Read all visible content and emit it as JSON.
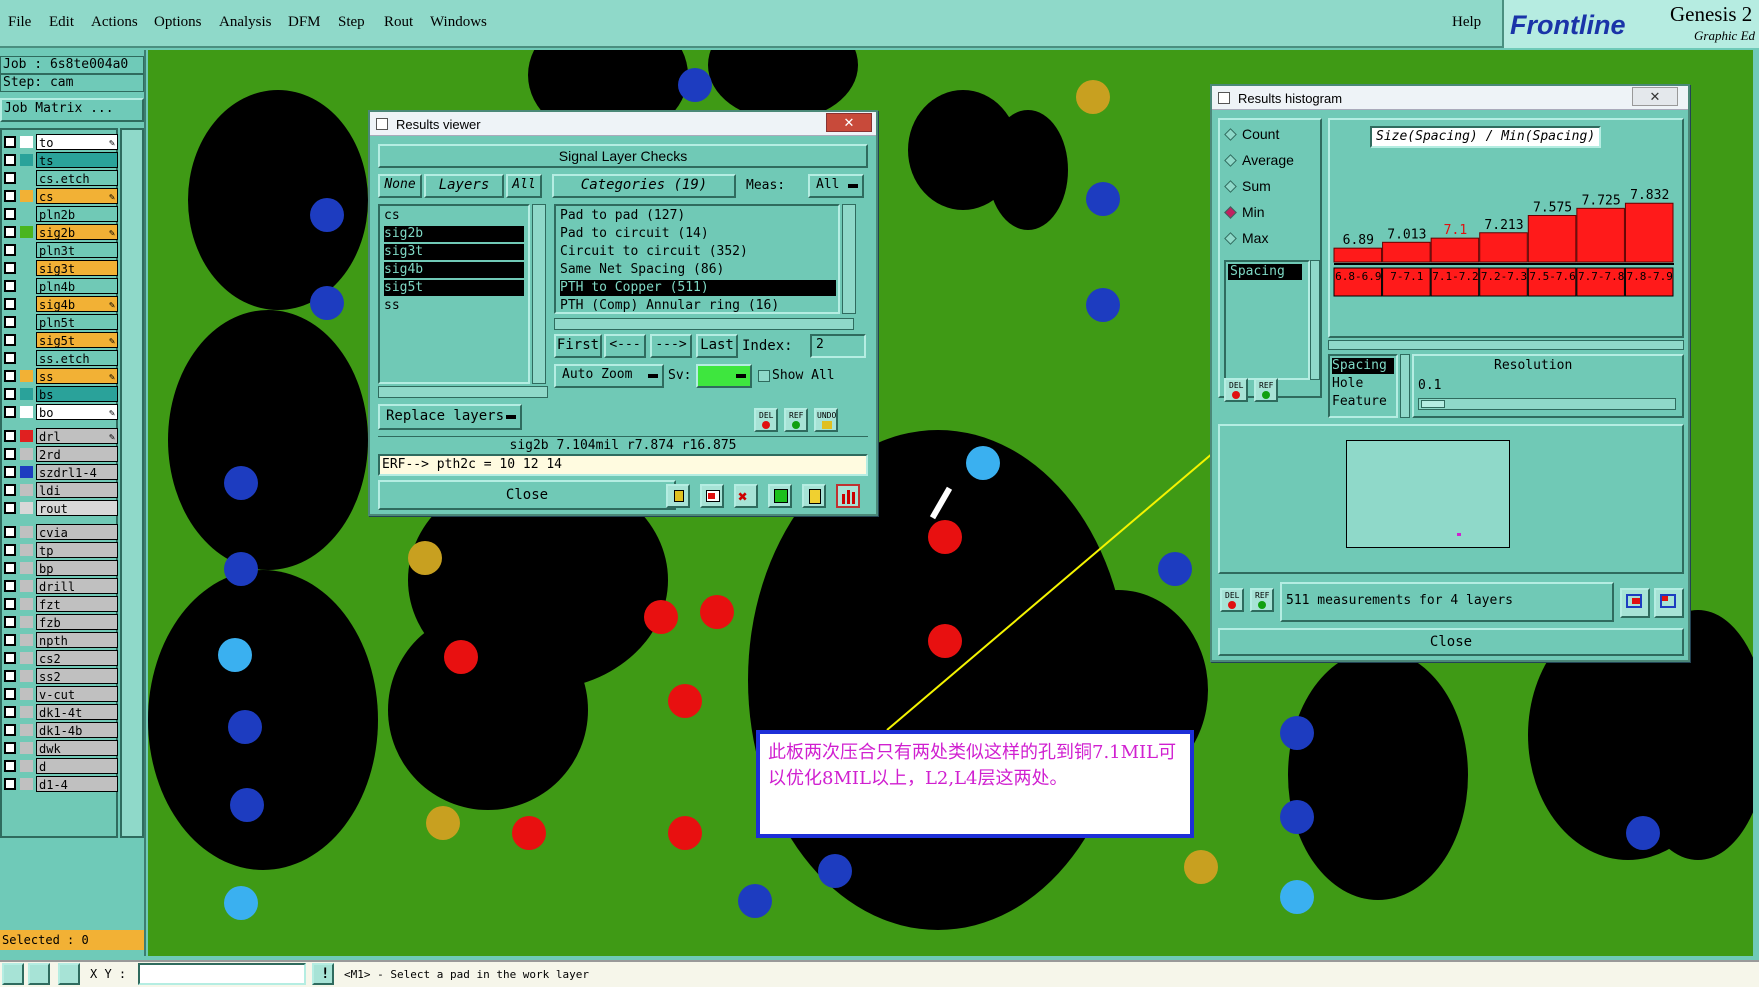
{
  "menubar": {
    "items": [
      "File",
      "Edit",
      "Actions",
      "Options",
      "Analysis",
      "DFM",
      "Step",
      "Rout",
      "Windows"
    ],
    "help": "Help"
  },
  "logo": {
    "brand": "Frontline",
    "product": "Genesis 2",
    "edition": "Graphic Ed"
  },
  "job": {
    "job_label": "Job : 6s8te004a0",
    "step_label": "Step: cam",
    "matrix_label": "Job Matrix ..."
  },
  "layers": [
    {
      "name": "to",
      "bg": "#ffffff",
      "sw": "#ffffff",
      "edit": true
    },
    {
      "name": "ts",
      "bg": "#2aa29a",
      "sw": "#2aa29a",
      "edit": false
    },
    {
      "name": "cs.etch",
      "bg": "#70c9b6",
      "sw": "#70c9b6",
      "edit": false
    },
    {
      "name": "cs",
      "bg": "#f2b135",
      "sw": "#f2b135",
      "edit": true
    },
    {
      "name": "pln2b",
      "bg": "#70c9b6",
      "sw": "#70c9b6",
      "edit": false
    },
    {
      "name": "sig2b",
      "bg": "#f2b135",
      "sw": "#4ab51e",
      "edit": true
    },
    {
      "name": "pln3t",
      "bg": "#70c9b6",
      "sw": "#70c9b6",
      "edit": false
    },
    {
      "name": "sig3t",
      "bg": "#f2b135",
      "sw": "#70c9b6",
      "edit": false
    },
    {
      "name": "pln4b",
      "bg": "#70c9b6",
      "sw": "#70c9b6",
      "edit": false
    },
    {
      "name": "sig4b",
      "bg": "#f2b135",
      "sw": "#70c9b6",
      "edit": true
    },
    {
      "name": "pln5t",
      "bg": "#70c9b6",
      "sw": "#70c9b6",
      "edit": false
    },
    {
      "name": "sig5t",
      "bg": "#f2b135",
      "sw": "#70c9b6",
      "edit": true
    },
    {
      "name": "ss.etch",
      "bg": "#70c9b6",
      "sw": "#70c9b6",
      "edit": false
    },
    {
      "name": "ss",
      "bg": "#f2b135",
      "sw": "#f2b135",
      "edit": true
    },
    {
      "name": "bs",
      "bg": "#2aa29a",
      "sw": "#2aa29a",
      "edit": false
    },
    {
      "name": "bo",
      "bg": "#ffffff",
      "sw": "#ffffff",
      "edit": true
    },
    {
      "name": "drl",
      "bg": "#c0c0c0",
      "sw": "#e02020",
      "edit": true
    },
    {
      "name": "2rd",
      "bg": "#c0c0c0",
      "sw": "#c0c0c0",
      "edit": false
    },
    {
      "name": "szdrl1-4",
      "bg": "#c0c0c0",
      "sw": "#1d3cc0",
      "edit": false
    },
    {
      "name": "ldi",
      "bg": "#c0c0c0",
      "sw": "#c0c0c0",
      "edit": false
    },
    {
      "name": "rout",
      "bg": "#d8d8d8",
      "sw": "#d8d8d8",
      "edit": false
    },
    {
      "name": "cvia",
      "bg": "#c0c0c0",
      "sw": "#c0c0c0",
      "edit": false
    },
    {
      "name": "tp",
      "bg": "#c0c0c0",
      "sw": "#c0c0c0",
      "edit": false
    },
    {
      "name": "bp",
      "bg": "#c0c0c0",
      "sw": "#c0c0c0",
      "edit": false
    },
    {
      "name": "drill",
      "bg": "#c0c0c0",
      "sw": "#c0c0c0",
      "edit": false
    },
    {
      "name": "fzt",
      "bg": "#c0c0c0",
      "sw": "#c0c0c0",
      "edit": false
    },
    {
      "name": "fzb",
      "bg": "#c0c0c0",
      "sw": "#c0c0c0",
      "edit": false
    },
    {
      "name": "npth",
      "bg": "#c0c0c0",
      "sw": "#c0c0c0",
      "edit": false
    },
    {
      "name": "cs2",
      "bg": "#c0c0c0",
      "sw": "#c0c0c0",
      "edit": false
    },
    {
      "name": "ss2",
      "bg": "#c0c0c0",
      "sw": "#c0c0c0",
      "edit": false
    },
    {
      "name": "v-cut",
      "bg": "#c0c0c0",
      "sw": "#c0c0c0",
      "edit": false
    },
    {
      "name": "dk1-4t",
      "bg": "#c0c0c0",
      "sw": "#c0c0c0",
      "edit": false
    },
    {
      "name": "dk1-4b",
      "bg": "#c0c0c0",
      "sw": "#c0c0c0",
      "edit": false
    },
    {
      "name": "dwk",
      "bg": "#c0c0c0",
      "sw": "#c0c0c0",
      "edit": false
    },
    {
      "name": "d",
      "bg": "#c0c0c0",
      "sw": "#c0c0c0",
      "edit": false
    },
    {
      "name": "d1-4",
      "bg": "#c0c0c0",
      "sw": "#c0c0c0",
      "edit": false
    }
  ],
  "selected_label": "Selected : 0",
  "results_viewer": {
    "title": "Results viewer",
    "header": "Signal Layer Checks",
    "none_btn": "None",
    "layers_btn": "Layers",
    "all_btn": "All",
    "categories_btn": "Categories (19)",
    "meas_label": "Meas:",
    "meas_value": "All",
    "layer_list": [
      "cs",
      "sig2b",
      "sig3t",
      "sig4b",
      "sig5t",
      "ss"
    ],
    "layer_selected": [
      false,
      true,
      true,
      true,
      true,
      false
    ],
    "category_list": [
      "Pad to pad (127)",
      "Pad to circuit (14)",
      "Circuit to circuit (352)",
      "Same Net Spacing (86)",
      "PTH to Copper (511)",
      "PTH (Comp) Annular ring (16)"
    ],
    "category_selected_index": 4,
    "first_btn": "First",
    "prev_btn": "<---",
    "next_btn": "--->",
    "last_btn": "Last",
    "index_label": "Index:",
    "index_value": "2",
    "auto_zoom": "Auto Zoom",
    "sv_label": "Sv:",
    "show_all": "Show All",
    "replace_layers": "Replace layers",
    "info": "sig2b 7.104mil   r7.874   r16.875",
    "erf": "ERF--> pth2c = 10 12 14",
    "close": "Close"
  },
  "histogram": {
    "title": "Results histogram",
    "modes": [
      "Count",
      "Average",
      "Sum",
      "Min",
      "Max"
    ],
    "mode_selected_index": 3,
    "list_item": "Spacing",
    "chart_title": "Size(Spacing) / Min(Spacing)",
    "sub_list": [
      "Spacing",
      "Hole",
      "Feature"
    ],
    "resolution_label": "Resolution",
    "resolution_value": "0.1",
    "measurements": "511 measurements for 4 layers",
    "close": "Close"
  },
  "chart_data": {
    "type": "bar",
    "title": "Size(Spacing) / Min(Spacing)",
    "categories": [
      "6.8-6.9",
      "7-7.1",
      "7.1-7.2",
      "7.2-7.3",
      "7.5-7.6",
      "7.7-7.8",
      "7.8-7.9"
    ],
    "values": [
      6.89,
      7.013,
      7.1,
      7.213,
      7.575,
      7.725,
      7.832
    ],
    "value_labels": [
      "6.89",
      "7.013",
      "7.1",
      "7.213",
      "7.575",
      "7.725",
      "7.832"
    ],
    "bar_color": "#ff1a1a",
    "highlight_label_color": "#e01010"
  },
  "annotation": {
    "text": "此板两次压合只有两处类似这样的孔到铜7.1MIL可以优化8MIL以上，L2,L4层这两处。",
    "text_color": "#d020d0",
    "border_color": "#1d2fd8"
  },
  "statusbar": {
    "xy_label": "X Y :",
    "message": "<M1> - Select a pad in the work layer"
  }
}
